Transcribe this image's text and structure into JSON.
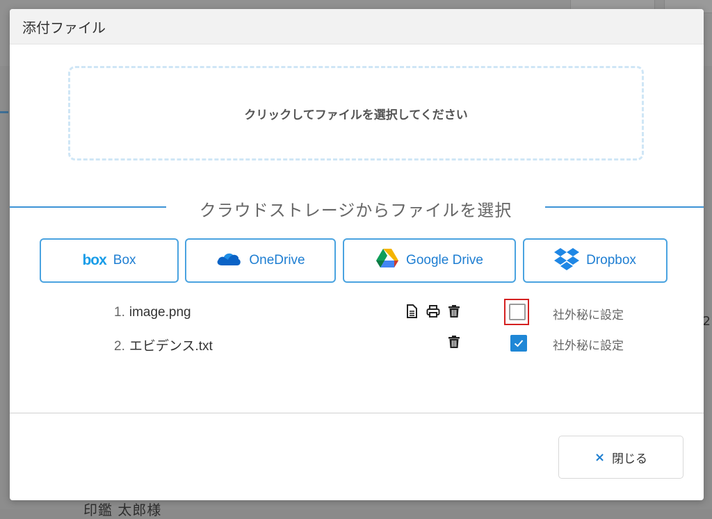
{
  "background": {
    "bottom_text": "印鑑 太郎様",
    "right_text": "2"
  },
  "dialog": {
    "title": "添付ファイル",
    "dropzone_label": "クリックしてファイルを選択してください",
    "cloud_section_label": "クラウドストレージからファイルを選択",
    "cloud_buttons": [
      {
        "label": "Box",
        "icon": "box-logo-icon",
        "logo_text": "box"
      },
      {
        "label": "OneDrive",
        "icon": "onedrive-cloud-icon"
      },
      {
        "label": "Google Drive",
        "icon": "google-drive-icon"
      },
      {
        "label": "Dropbox",
        "icon": "dropbox-icon"
      }
    ],
    "files": [
      {
        "index": "1.",
        "name": "image.png",
        "actions": [
          "preview-icon",
          "print-icon",
          "trash-icon"
        ],
        "confidential": false,
        "confidential_label": "社外秘に設定"
      },
      {
        "index": "2.",
        "name": "エビデンス.txt",
        "actions": [
          "trash-icon"
        ],
        "confidential": true,
        "confidential_label": "社外秘に設定"
      }
    ],
    "close_label": "閉じる",
    "close_icon": "×"
  },
  "colors": {
    "accent": "#1f87d6",
    "focus_outline": "#d42020",
    "dropzone_border": "#cfe6f6"
  }
}
